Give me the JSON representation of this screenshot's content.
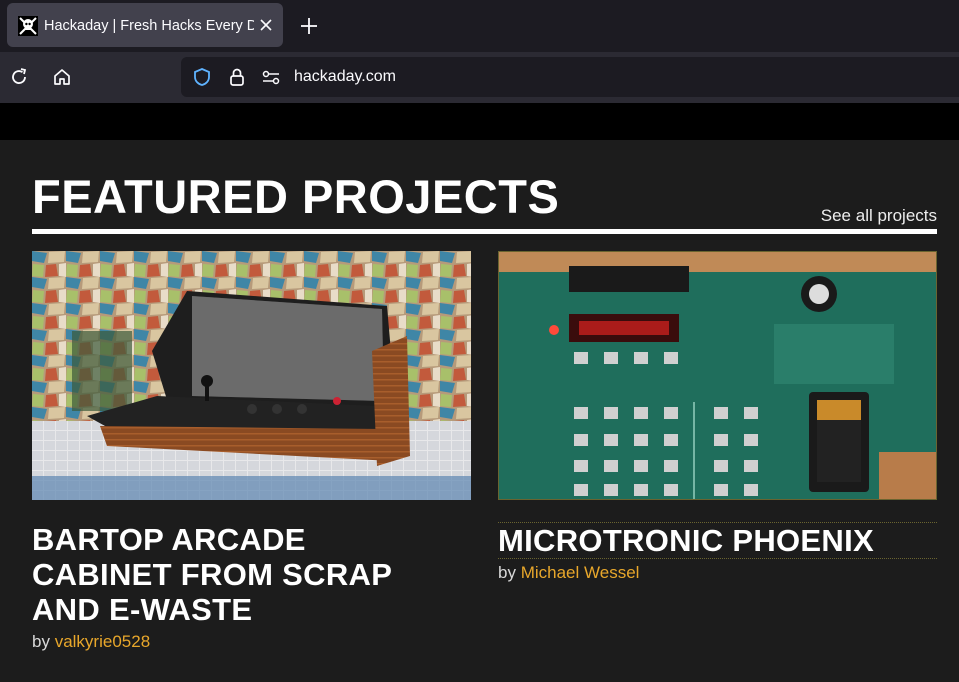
{
  "browser": {
    "tab": {
      "title": "Hackaday | Fresh Hacks Every Day",
      "favicon": "hackaday-skull-icon"
    },
    "url": "hackaday.com",
    "icons": [
      "reload-icon",
      "home-icon",
      "shield-icon",
      "lock-icon",
      "permissions-icon",
      "close-icon",
      "plus-icon"
    ]
  },
  "section": {
    "title": "FEATURED PROJECTS",
    "see_all": "See all projects"
  },
  "projects": [
    {
      "title": "BARTOP ARCADE CABINET FROM SCRAP AND E-WASTE",
      "by": "by",
      "author": "valkyrie0528"
    },
    {
      "title": "MICROTRONIC PHOENIX",
      "by": "by",
      "author": "Michael Wessel"
    }
  ],
  "colors": {
    "page_bg": "#1c1c1c",
    "author": "#e8a72b",
    "tab_active": "#42414d",
    "url_bg": "#1c1b22"
  }
}
